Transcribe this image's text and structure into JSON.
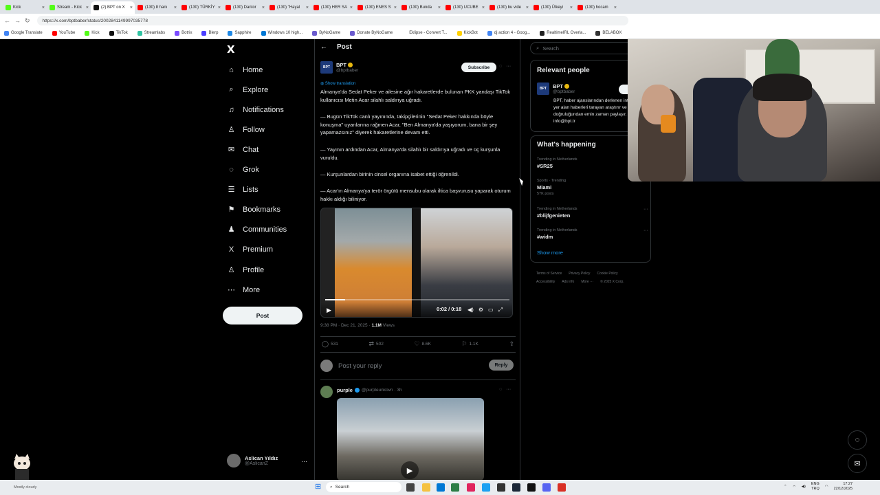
{
  "browser": {
    "tabs": [
      {
        "title": "Kick",
        "color": "#53fc18"
      },
      {
        "title": "Stream - Kick",
        "color": "#53fc18"
      },
      {
        "title": "(2) BPT on X",
        "color": "#111111",
        "active": true
      },
      {
        "title": "(130) 8 hanı",
        "color": "#ff0000"
      },
      {
        "title": "(130) TÜRKİY",
        "color": "#ff0000"
      },
      {
        "title": "(130) Dantor",
        "color": "#ff0000"
      },
      {
        "title": "(130) \"Hayal",
        "color": "#ff0000"
      },
      {
        "title": "(130) HER SA",
        "color": "#ff0000"
      },
      {
        "title": "(130) ENES S",
        "color": "#ff0000"
      },
      {
        "title": "(130) Bunda",
        "color": "#ff0000"
      },
      {
        "title": "(130) UCUBE",
        "color": "#ff0000"
      },
      {
        "title": "(130) bu vide",
        "color": "#ff0000"
      },
      {
        "title": "(130) Ülkeyi",
        "color": "#ff0000"
      },
      {
        "title": "(130) hocam",
        "color": "#ff0000"
      }
    ],
    "url": "https://x.com/bptbaber/status/2002841149997035778",
    "bookmarks": [
      {
        "label": "Google Translate",
        "color": "#4285f4"
      },
      {
        "label": "YouTube",
        "color": "#ff0000"
      },
      {
        "label": "Kick",
        "color": "#53fc18"
      },
      {
        "label": "TikTok",
        "color": "#111111"
      },
      {
        "label": "Streamlabs",
        "color": "#31c3a2"
      },
      {
        "label": "Botrix",
        "color": "#7b4cff"
      },
      {
        "label": "Blerp",
        "color": "#4b3fff"
      },
      {
        "label": "Sapphire",
        "color": "#1e88e5"
      },
      {
        "label": "Windows 10 high...",
        "color": "#0078d4"
      },
      {
        "label": "ByNoGame",
        "color": "#6a5acd"
      },
      {
        "label": "Donate ByNoGame",
        "color": "#6a5acd"
      },
      {
        "label": "Eklipse - Convert T...",
        "color": "#ffffff"
      },
      {
        "label": "KickBot",
        "color": "#ffd000"
      },
      {
        "label": "dj action 4 - Goog...",
        "color": "#4285f4"
      },
      {
        "label": "RealtimeIRL Overla...",
        "color": "#222222"
      },
      {
        "label": "BELABOX",
        "color": "#333333"
      }
    ]
  },
  "sidebar": {
    "logo": "X",
    "items": [
      {
        "label": "Home",
        "icon": "⌂"
      },
      {
        "label": "Explore",
        "icon": "⌕"
      },
      {
        "label": "Notifications",
        "icon": "♫"
      },
      {
        "label": "Follow",
        "icon": "♙"
      },
      {
        "label": "Chat",
        "icon": "✉"
      },
      {
        "label": "Grok",
        "icon": "◌"
      },
      {
        "label": "Lists",
        "icon": "☰"
      },
      {
        "label": "Bookmarks",
        "icon": "⚑"
      },
      {
        "label": "Communities",
        "icon": "♟"
      },
      {
        "label": "Premium",
        "icon": "X"
      },
      {
        "label": "Profile",
        "icon": "♙"
      },
      {
        "label": "More",
        "icon": "⋯"
      }
    ],
    "post_button": "Post",
    "account": {
      "name": "Aslican Yıldız",
      "handle": "@AslicanZ"
    }
  },
  "post": {
    "header": "Post",
    "author": {
      "name": "BPT",
      "handle": "@bptbaber",
      "logo": "BPT"
    },
    "subscribe": "Subscribe",
    "show_translation": "Show translation",
    "paragraphs": [
      "Almanya'da Sedat Peker ve ailesine ağır hakaretlerde bulunan PKK yandaşı TikTok kullanıcısı Metin Acar silahlı saldırıya uğradı.",
      "— Bugün TikTok canlı yayınında, takipçilerinin \"Sedat Peker hakkında böyle konuşma\" uyarılarına rağmen Acar, \"Ben Almanya'da yaşıyorum, bana bir şey yapamazsınız\" diyerek hakaretlerine devam etti.",
      "— Yayının ardından Acar, Almanya'da silahlı bir saldırıya uğradı ve üç kurşunla vuruldu.",
      "— Kurşunlardan birinin cinsel organına isabet ettiği öğrenildi.",
      "— Acar'ın Almanya'ya terör örgütü mensubu olarak iltica başvurusu yaparak oturum hakkı aldığı biliniyor."
    ],
    "video": {
      "time": "0:02 / 0:18",
      "progress": 0.11
    },
    "timestamp": "9:38 PM · Dec 21, 2025 · ",
    "views_count": "1.1M",
    "views_label": "Views",
    "stats": {
      "replies": "531",
      "reposts": "502",
      "likes": "8.6K",
      "bookmarks": "1.1K"
    },
    "reply_placeholder": "Post your reply",
    "reply_button": "Reply"
  },
  "comment": {
    "name": "purple",
    "handle": "@purpleunkovn · 3h"
  },
  "right": {
    "search_placeholder": "Search",
    "relevant_title": "Relevant people",
    "relevant_person": {
      "name": "BPT",
      "handle": "@bptbaber",
      "follow": "F",
      "bio": "BPT, haber ajanslarından derlenen internette yer alan haberleri tarayan araştırır ve doğruluğundan emin zaman paylaşır. info@bpt.tr"
    },
    "happening_title": "What's happening",
    "trends": [
      {
        "context": "Trending in Netherlands",
        "tag": "#SR25",
        "posts": ""
      },
      {
        "context": "Sports · Trending",
        "tag": "Miami",
        "posts": "57K posts"
      },
      {
        "context": "Trending in Netherlands",
        "tag": "#blijfgenieten",
        "posts": ""
      },
      {
        "context": "Trending in Netherlands",
        "tag": "#widm",
        "posts": ""
      }
    ],
    "show_more": "Show more",
    "footer": [
      "Terms of Service",
      "Privacy Policy",
      "Cookie Policy",
      "Accessibility",
      "Ads info",
      "More ···",
      "© 2025 X Corp."
    ]
  },
  "taskbar": {
    "search": "Search",
    "lang": "ENG",
    "lang2": "TRQ",
    "time": "17:27",
    "date": "22/12/2025",
    "weather": "Mostly cloudy"
  }
}
